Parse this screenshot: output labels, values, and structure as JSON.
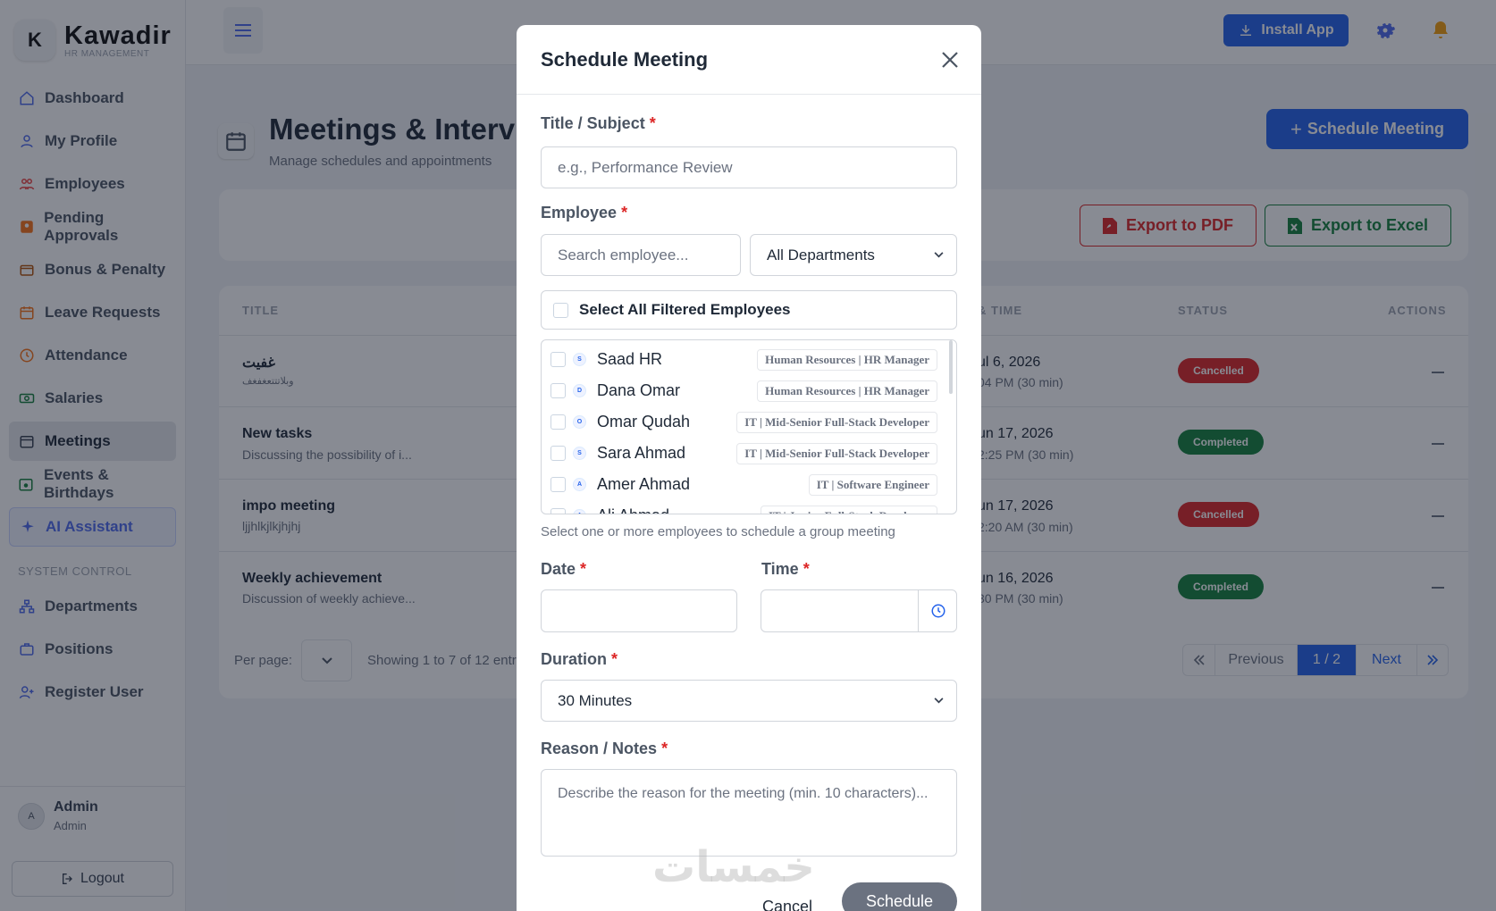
{
  "brand": {
    "letter": "K",
    "name": "Kawadir",
    "subtitle": "HR MANAGEMENT"
  },
  "sidebar": {
    "items": [
      {
        "label": "Dashboard",
        "icon": "home-icon"
      },
      {
        "label": "My Profile",
        "icon": "user-icon"
      },
      {
        "label": "Employees",
        "icon": "users-icon"
      },
      {
        "label": "Pending Approvals",
        "icon": "approvals-icon"
      },
      {
        "label": "Bonus & Penalty",
        "icon": "wallet-icon"
      },
      {
        "label": "Leave Requests",
        "icon": "calendar-icon"
      },
      {
        "label": "Attendance",
        "icon": "clock-icon"
      },
      {
        "label": "Salaries",
        "icon": "money-icon"
      },
      {
        "label": "Meetings",
        "icon": "calendar-icon",
        "active": true
      },
      {
        "label": "Events & Birthdays",
        "icon": "calendar-icon"
      },
      {
        "label": "AI Assistant",
        "icon": "sparkle-icon"
      }
    ],
    "section": "SYSTEM CONTROL",
    "system_items": [
      {
        "label": "Departments",
        "icon": "sitemap-icon"
      },
      {
        "label": "Positions",
        "icon": "briefcase-icon"
      },
      {
        "label": "Register User",
        "icon": "user-plus-icon"
      }
    ],
    "user": {
      "initial": "A",
      "name": "Admin",
      "role": "Admin"
    },
    "logout": "Logout"
  },
  "topbar": {
    "install": "Install App"
  },
  "page": {
    "title": "Meetings & Interviews",
    "subtitle": "Manage schedules and appointments",
    "schedule_button": "Schedule Meeting"
  },
  "toolbar": {
    "pdf": "Export to PDF",
    "excel": "Export to Excel"
  },
  "table": {
    "headers": {
      "title": "TITLE",
      "datetime": "& TIME",
      "status": "STATUS",
      "actions": "ACTIONS"
    },
    "rows": [
      {
        "title": "غفيت",
        "desc": "وبلاتتتعغفغف",
        "date": "ul 6, 2026",
        "time": "04 PM  (30 min)",
        "status": "Cancelled",
        "action": "—"
      },
      {
        "title": "New tasks",
        "desc": "Discussing the possibility of i...",
        "date": "un 17, 2026",
        "time": "2:25 PM  (30 min)",
        "status": "Completed",
        "action": "—"
      },
      {
        "title": "impo meeting",
        "desc": "ljjhlkjlkjhjhj",
        "date": "un 17, 2026",
        "time": "2:20 AM  (30 min)",
        "status": "Cancelled",
        "action": "—"
      },
      {
        "title": "Weekly achievement",
        "desc": "Discussion of weekly achieve...",
        "date": "un 16, 2026",
        "time": "30 PM  (30 min)",
        "status": "Completed",
        "action": "—"
      }
    ],
    "per_page_label": "Per page:",
    "showing": "Showing 1 to 7 of 12 entries",
    "pagination": {
      "previous": "Previous",
      "current": "1 / 2",
      "next": "Next"
    }
  },
  "modal": {
    "title": "Schedule Meeting",
    "subject_label": "Title / Subject",
    "subject_placeholder": "e.g., Performance Review",
    "employee_label": "Employee",
    "search_placeholder": "Search employee...",
    "department_select": "All Departments",
    "select_all": "Select All Filtered Employees",
    "employees": [
      {
        "initial": "S",
        "name": "Saad HR",
        "tag": "Human Resources | HR Manager"
      },
      {
        "initial": "D",
        "name": "Dana Omar",
        "tag": "Human Resources | HR Manager"
      },
      {
        "initial": "O",
        "name": "Omar Qudah",
        "tag": "IT | Mid-Senior Full-Stack Developer"
      },
      {
        "initial": "S",
        "name": "Sara Ahmad",
        "tag": "IT | Mid-Senior Full-Stack Developer"
      },
      {
        "initial": "A",
        "name": "Amer Ahmad",
        "tag": "IT | Software Engineer"
      },
      {
        "initial": "A",
        "name": "Ali Ahmad",
        "tag": "IT | Junior Full-Stack Developer"
      }
    ],
    "hint": "Select one or more employees to schedule a group meeting",
    "date_label": "Date",
    "time_label": "Time",
    "duration_label": "Duration",
    "duration_value": "30 Minutes",
    "notes_label": "Reason / Notes",
    "notes_placeholder": "Describe the reason for the meeting (min. 10 characters)...",
    "required_mark": "*",
    "cancel": "Cancel",
    "schedule": "Schedule"
  },
  "watermark": "خمسات",
  "colors": {
    "primary": "#2563eb",
    "danger": "#dc2626",
    "success": "#15803d"
  }
}
